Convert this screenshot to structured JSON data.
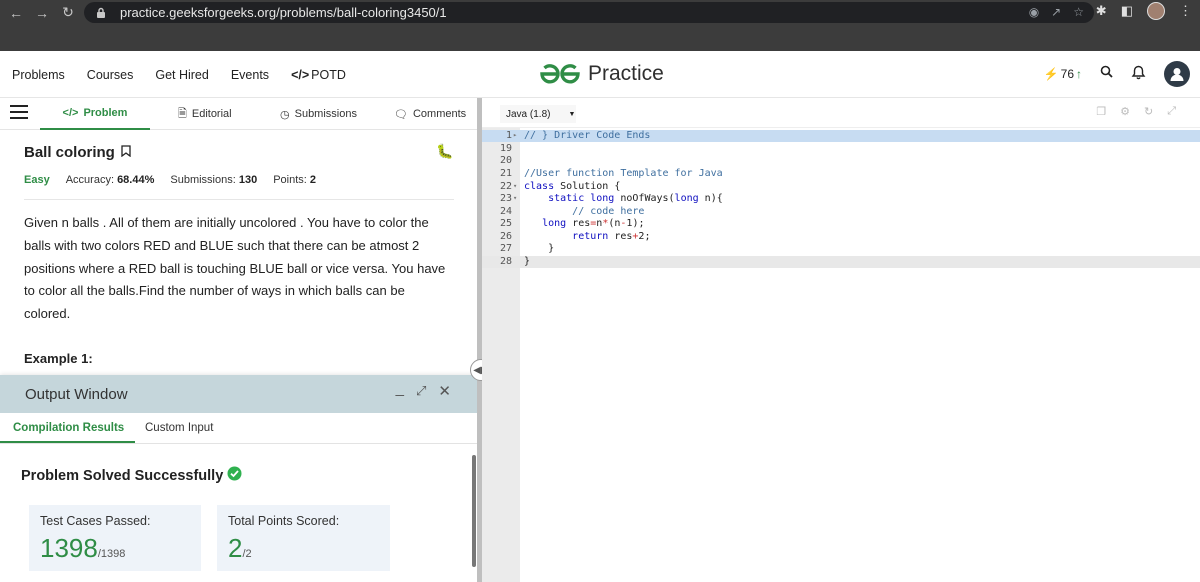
{
  "browser": {
    "url": "practice.geeksforgeeks.org/problems/ball-coloring3450/1"
  },
  "header": {
    "nav": [
      "Problems",
      "Courses",
      "Get Hired",
      "Events",
      "POTD"
    ],
    "logo_text": "Practice",
    "streak": "76"
  },
  "tabs": [
    "Problem",
    "Editorial",
    "Submissions",
    "Comments"
  ],
  "problem": {
    "title": "Ball coloring",
    "difficulty": "Easy",
    "accuracy_label": "Accuracy:",
    "accuracy": "68.44%",
    "submissions_label": "Submissions:",
    "submissions": "130",
    "points_label": "Points:",
    "points": "2",
    "description": "Given n balls . All of them are initially  uncolored . You have to color the balls with two colors RED and BLUE such that there can be atmost 2 positions where a RED ball is touching BLUE ball or vice versa. You have to color all the balls.Find the number of ways in which balls can be colored.",
    "example_heading": "Example 1:"
  },
  "output": {
    "title": "Output Window",
    "tabs": [
      "Compilation Results",
      "Custom Input"
    ],
    "status": "Problem Solved Successfully",
    "test_cases_label": "Test Cases Passed:",
    "test_cases_value": "1398",
    "test_cases_total": "/1398",
    "points_label": "Total Points Scored:",
    "points_value": "2",
    "points_total": "/2"
  },
  "editor": {
    "language": "Java (1.8)",
    "lines": [
      {
        "n": "1",
        "fold": "▸",
        "html": "<span class='c-com'>// } Driver Code Ends</span>"
      },
      {
        "n": "19",
        "fold": "",
        "html": ""
      },
      {
        "n": "20",
        "fold": "",
        "html": ""
      },
      {
        "n": "21",
        "fold": "",
        "html": "<span class='c-com'>//User function Template for Java</span>"
      },
      {
        "n": "22",
        "fold": "▾",
        "html": "<span class='c-kw'>class</span> <span class='c-pl'>Solution {</span>"
      },
      {
        "n": "23",
        "fold": "▾",
        "html": "    <span class='c-kw'>static long</span> <span class='c-pl'>noOfWays(</span><span class='c-kw'>long</span> <span class='c-pl'>n){</span>"
      },
      {
        "n": "24",
        "fold": "",
        "html": "        <span class='c-com'>// code here</span>"
      },
      {
        "n": "25",
        "fold": "",
        "html": "   <span class='c-kw'>long</span> <span class='c-pl'>res</span><span class='c-op'>=</span><span class='c-pl'>n</span><span class='c-op'>*</span><span class='c-pl'>(n</span><span class='c-op'>-</span><span class='c-pl'>1);</span>"
      },
      {
        "n": "26",
        "fold": "",
        "html": "        <span class='c-kw'>return</span> <span class='c-pl'>res</span><span class='c-op'>+</span><span class='c-pl'>2;</span>"
      },
      {
        "n": "27",
        "fold": "",
        "html": "    <span class='c-pl'>}</span>"
      },
      {
        "n": "28",
        "fold": "",
        "html": "<span class='c-pl'>}</span>"
      }
    ]
  }
}
